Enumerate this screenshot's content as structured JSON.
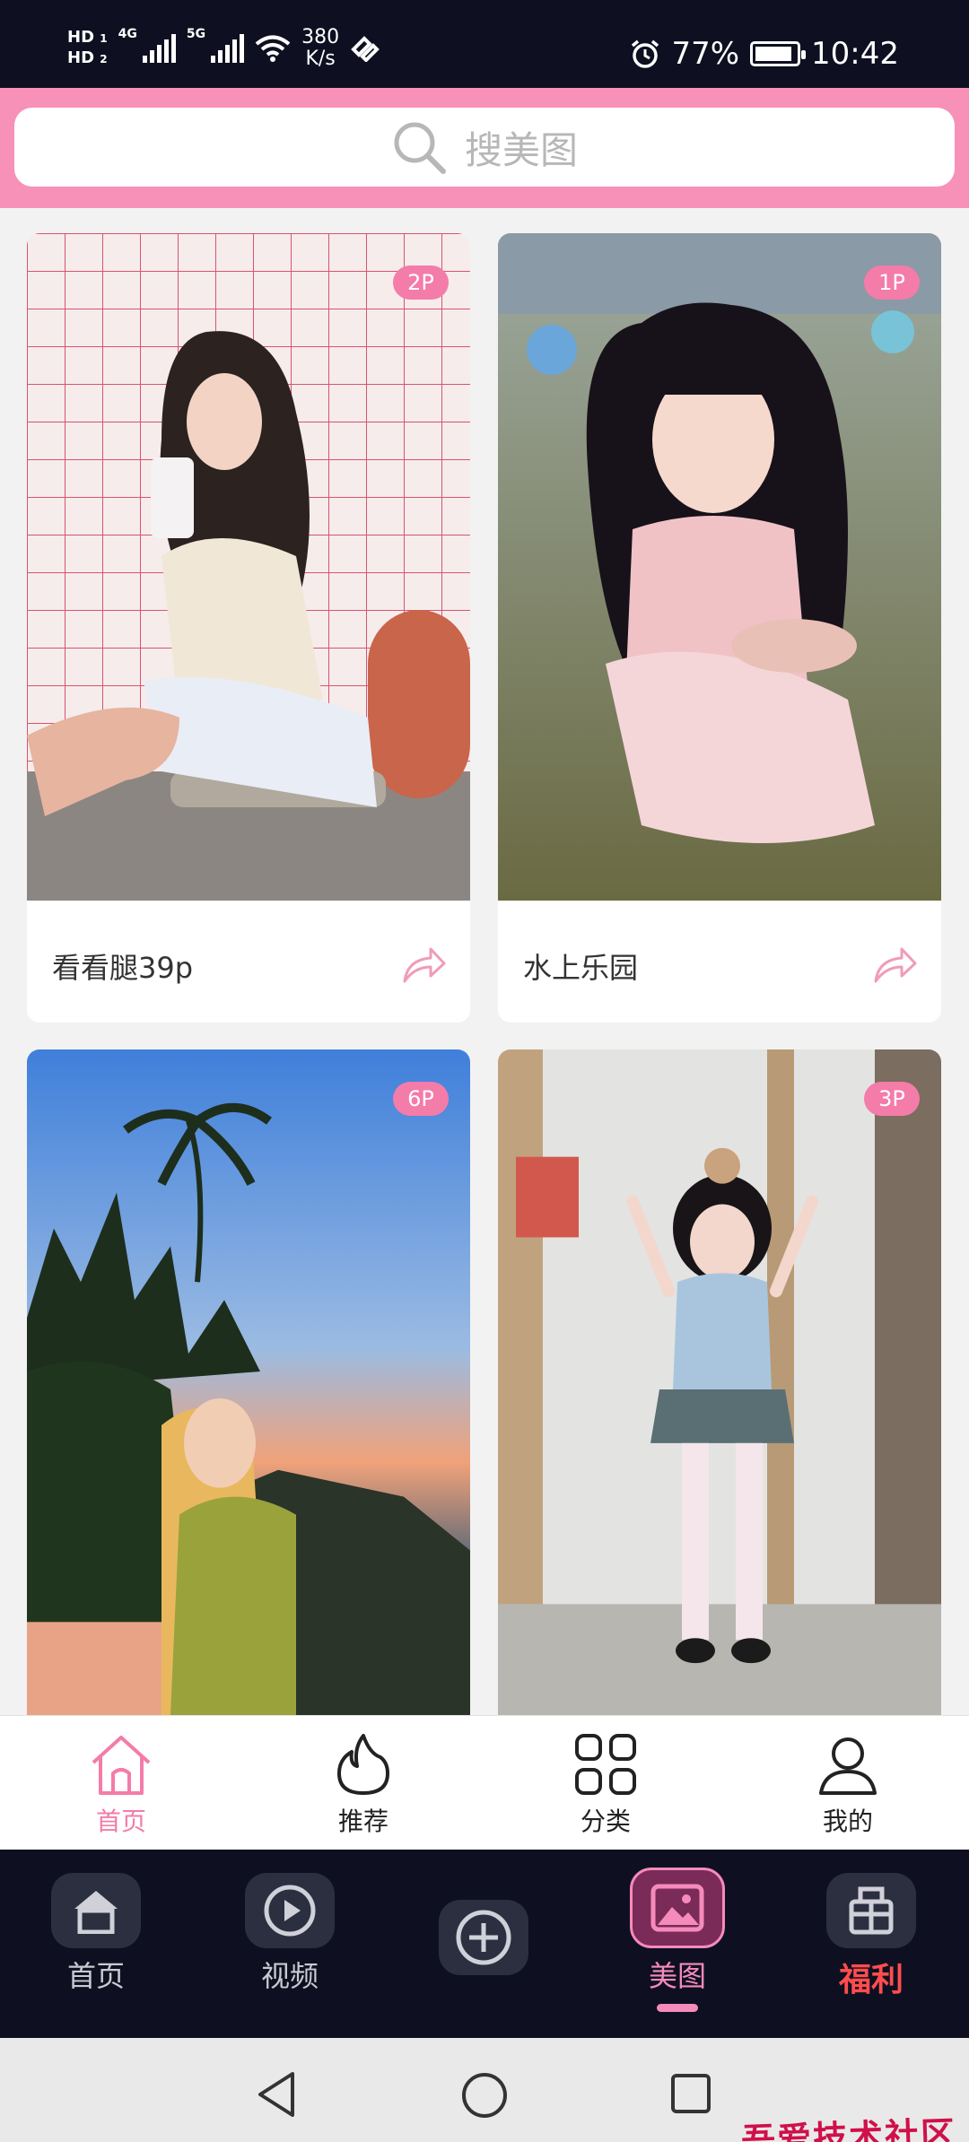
{
  "status_bar": {
    "hd1": "HD",
    "hd1_sim": "1",
    "hd2": "HD",
    "hd2_sim": "2",
    "net1": "4G",
    "net2": "5G",
    "speed_value": "380",
    "speed_unit": "K/s",
    "battery": "77%",
    "time": "10:42"
  },
  "search": {
    "placeholder": "搜美图"
  },
  "cards": [
    {
      "badge": "2P",
      "caption": "看看腿39p"
    },
    {
      "badge": "1P",
      "caption": "水上乐园"
    },
    {
      "badge": "6P",
      "caption": ""
    },
    {
      "badge": "3P",
      "caption": ""
    }
  ],
  "inner_tabs": [
    {
      "label": "首页",
      "active": true
    },
    {
      "label": "推荐",
      "active": false
    },
    {
      "label": "分类",
      "active": false
    },
    {
      "label": "我的",
      "active": false
    }
  ],
  "app_nav": [
    {
      "label": "首页"
    },
    {
      "label": "视频"
    },
    {
      "label": ""
    },
    {
      "label": "美图",
      "active": true
    },
    {
      "label": "福利"
    }
  ],
  "watermark": "吾爱技术社区",
  "colors": {
    "accent_pink": "#f47ca8",
    "header_pink": "#f791b7",
    "dark_bg": "#0e1021"
  }
}
